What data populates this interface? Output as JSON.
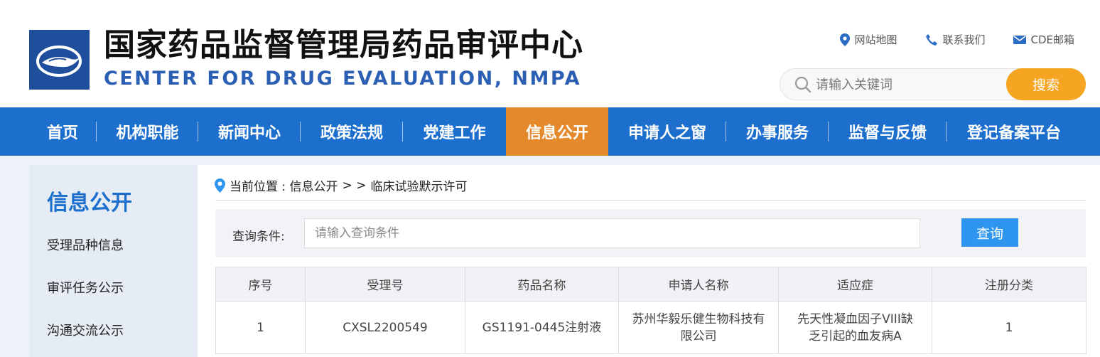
{
  "header": {
    "title_cn": "国家药品监督管理局药品审评中心",
    "title_en": "CENTER FOR DRUG EVALUATION, NMPA",
    "links": [
      {
        "label": "网站地图",
        "icon": "location-pin-icon"
      },
      {
        "label": "联系我们",
        "icon": "phone-icon"
      },
      {
        "label": "CDE邮箱",
        "icon": "mail-icon"
      }
    ],
    "search": {
      "placeholder": "请输入关键词",
      "button": "搜索"
    }
  },
  "nav": {
    "items": [
      {
        "label": "首页"
      },
      {
        "label": "机构职能"
      },
      {
        "label": "新闻中心"
      },
      {
        "label": "政策法规"
      },
      {
        "label": "党建工作"
      },
      {
        "label": "信息公开"
      },
      {
        "label": "申请人之窗"
      },
      {
        "label": "办事服务"
      },
      {
        "label": "监督与反馈"
      },
      {
        "label": "登记备案平台"
      }
    ],
    "active": "信息公开"
  },
  "sidebar": {
    "title": "信息公开",
    "items": [
      {
        "label": "受理品种信息"
      },
      {
        "label": "审评任务公示"
      },
      {
        "label": "沟通交流公示"
      }
    ]
  },
  "breadcrumb": {
    "prefix": "当前位置 : 信息公开",
    "separator": "> >",
    "current": "临床试验默示许可"
  },
  "query": {
    "label": "查询条件:",
    "placeholder": "请输入查询条件",
    "button": "查询"
  },
  "table": {
    "headers": [
      "序号",
      "受理号",
      "药品名称",
      "申请人名称",
      "适应症",
      "注册分类"
    ],
    "rows": [
      [
        "1",
        "CXSL2200549",
        "GS1191-0445注射液",
        "苏州华毅乐健生物科技有限公司",
        "先天性凝血因子VIII缺乏引起的血友病A",
        "1"
      ]
    ]
  },
  "colors": {
    "nav_bg": "#1d6fce",
    "nav_active": "#e48a2c",
    "search_button": "#f6a522",
    "query_button": "#2f96f0",
    "brand_blue": "#2b5fb3"
  }
}
